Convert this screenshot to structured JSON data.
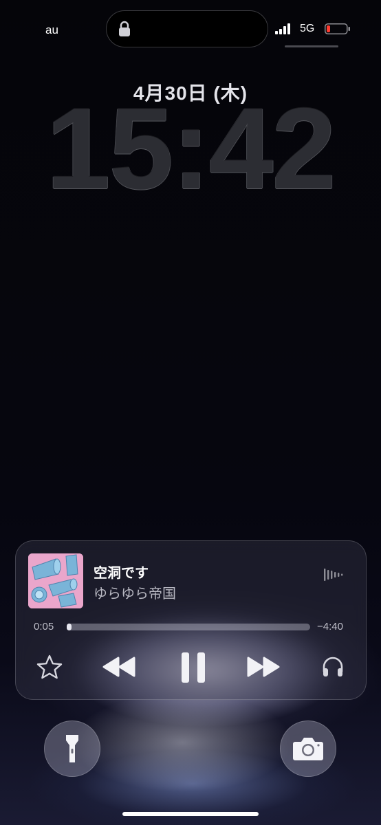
{
  "status_bar": {
    "carrier": "au",
    "network": "5G",
    "battery_color": "#ff3b30"
  },
  "lock_screen": {
    "date": "4月30日 (木)",
    "time": "15:42"
  },
  "now_playing": {
    "title": "空洞です",
    "artist": "ゆらゆら帝国",
    "elapsed": "0:05",
    "remaining": "−4:40",
    "progress": 0.02,
    "artwork_color": "#e9a8c9"
  },
  "icons": {
    "lock": "lock-icon",
    "signal": "signal-icon",
    "battery": "battery-icon",
    "waveform": "waveform-icon",
    "star": "star-icon",
    "rewind": "rewind-icon",
    "pause": "pause-icon",
    "forward": "fast-forward-icon",
    "airplay": "headphones-icon",
    "flashlight": "flashlight-icon",
    "camera": "camera-icon"
  }
}
